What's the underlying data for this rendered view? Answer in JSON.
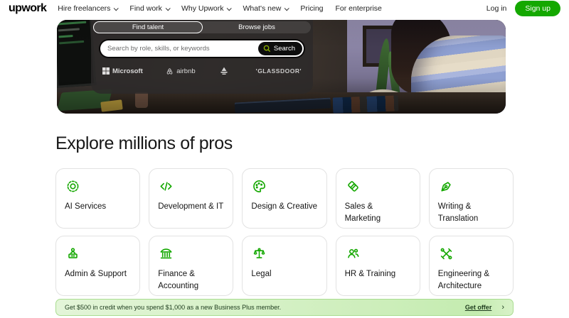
{
  "nav": {
    "logo_text": "upwork",
    "items": [
      {
        "label": "Hire freelancers",
        "has_dropdown": true
      },
      {
        "label": "Find work",
        "has_dropdown": true
      },
      {
        "label": "Why Upwork",
        "has_dropdown": true
      },
      {
        "label": "What's new",
        "has_dropdown": true
      },
      {
        "label": "Pricing",
        "has_dropdown": false
      },
      {
        "label": "For enterprise",
        "has_dropdown": false
      }
    ],
    "login_label": "Log in",
    "signup_label": "Sign up"
  },
  "hero": {
    "tabs": [
      {
        "label": "Find talent",
        "active": true
      },
      {
        "label": "Browse jobs",
        "active": false
      }
    ],
    "search": {
      "placeholder": "Search by role, skills, or keywords",
      "button_label": "Search"
    },
    "brands": [
      {
        "label": "Microsoft",
        "icon": "microsoft-logo-icon"
      },
      {
        "label": "airbnb",
        "icon": "airbnb-logo-icon"
      },
      {
        "label": "",
        "icon": "abstract-brand-mark-icon"
      },
      {
        "label": "'GLASSDOOR'",
        "icon": "glassdoor-logo-text"
      }
    ]
  },
  "explore": {
    "title": "Explore millions of pros",
    "categories": [
      {
        "label": "AI Services",
        "icon": "ai-services-icon"
      },
      {
        "label": "Development & IT",
        "icon": "development-it-icon"
      },
      {
        "label": "Design & Creative",
        "icon": "design-creative-icon"
      },
      {
        "label": "Sales & Marketing",
        "icon": "sales-marketing-icon"
      },
      {
        "label": "Writing & Translation",
        "icon": "writing-translation-icon"
      },
      {
        "label": "Admin & Support",
        "icon": "admin-support-icon"
      },
      {
        "label": "Finance & Accounting",
        "icon": "finance-accounting-icon"
      },
      {
        "label": "Legal",
        "icon": "legal-icon"
      },
      {
        "label": "HR & Training",
        "icon": "hr-training-icon"
      },
      {
        "label": "Engineering & Architecture",
        "icon": "engineering-architecture-icon"
      }
    ]
  },
  "banner": {
    "text": "Get $500 in credit when you spend $1,000 as a new Business Plus member.",
    "cta_label": "Get offer",
    "chevron": "›"
  },
  "colors": {
    "brand_green": "#14a800",
    "search_icon_green": "#8aad00",
    "banner_text": "#1d3b1d",
    "banner_border": "#a9dd90"
  }
}
